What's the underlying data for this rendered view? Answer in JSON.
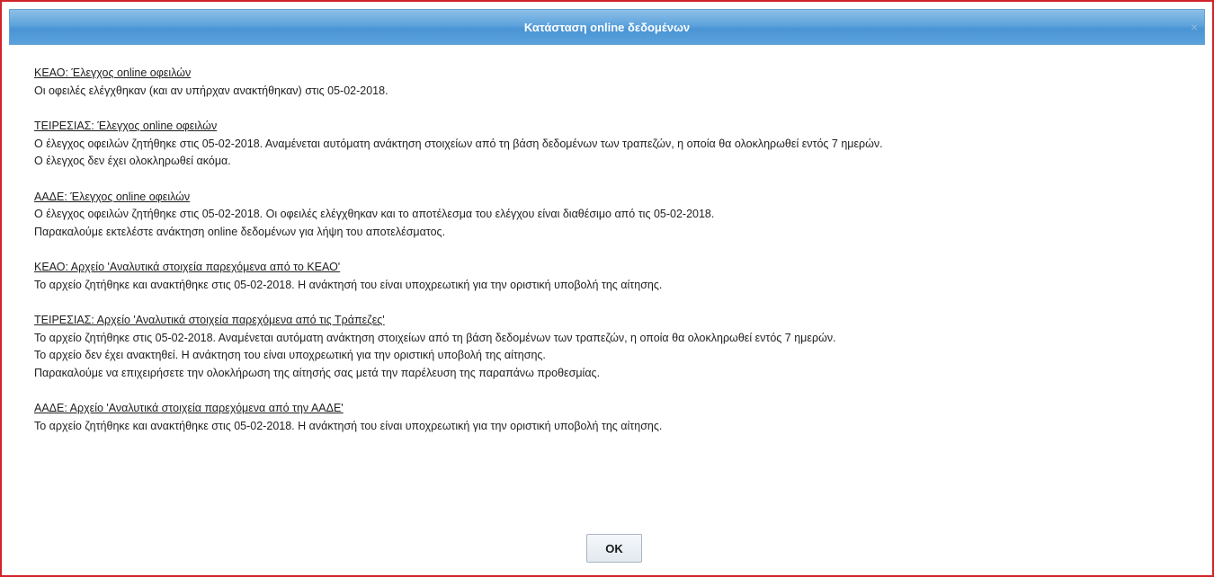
{
  "dialog": {
    "title": "Κατάσταση online δεδομένων",
    "close_icon": "×",
    "ok_label": "OK"
  },
  "sections": [
    {
      "title": "ΚΕΑΟ: Έλεγχος online οφειλών",
      "lines": [
        "Οι οφειλές ελέγχθηκαν (και αν υπήρχαν ανακτήθηκαν) στις 05-02-2018."
      ]
    },
    {
      "title": "ΤΕΙΡΕΣΙΑΣ: Έλεγχος online οφειλών",
      "lines": [
        "Ο έλεγχος οφειλών ζητήθηκε στις 05-02-2018. Αναμένεται αυτόματη ανάκτηση στοιχείων από τη βάση δεδομένων των τραπεζών, η οποία θα ολοκληρωθεί εντός 7 ημερών.",
        "Ο έλεγχος δεν έχει ολοκληρωθεί ακόμα."
      ]
    },
    {
      "title": "ΑΑΔΕ: Έλεγχος online οφειλών",
      "lines": [
        "Ο έλεγχος οφειλών ζητήθηκε στις 05-02-2018. Οι οφειλές ελέγχθηκαν και το αποτέλεσμα του ελέγχου είναι διαθέσιμο από τις 05-02-2018.",
        "Παρακαλούμε εκτελέστε ανάκτηση online δεδομένων για λήψη του αποτελέσματος."
      ]
    },
    {
      "title": "ΚΕΑΟ: Αρχείο 'Αναλυτικά στοιχεία παρεχόμενα από το ΚΕΑΟ'",
      "lines": [
        "Το αρχείο ζητήθηκε και ανακτήθηκε στις 05-02-2018. Η ανάκτησή του είναι υποχρεωτική για την οριστική υποβολή της αίτησης."
      ]
    },
    {
      "title": "ΤΕΙΡΕΣΙΑΣ: Αρχείο 'Αναλυτικά στοιχεία παρεχόμενα από τις Τράπεζες'",
      "lines": [
        "Το αρχείο ζητήθηκε στις 05-02-2018. Αναμένεται αυτόματη ανάκτηση στοιχείων από τη βάση δεδομένων των τραπεζών, η οποία θα ολοκληρωθεί εντός 7 ημερών.",
        "Το αρχείο δεν έχει ανακτηθεί. Η ανάκτηση του είναι υποχρεωτική για την οριστική υποβολή της αίτησης.",
        "Παρακαλούμε να επιχειρήσετε την ολοκλήρωση της αίτησής σας μετά την παρέλευση της παραπάνω προθεσμίας."
      ]
    },
    {
      "title": "ΑΑΔΕ: Αρχείο 'Αναλυτικά στοιχεία παρεχόμενα από την ΑΑΔΕ'",
      "lines": [
        "Το αρχείο ζητήθηκε και ανακτήθηκε στις 05-02-2018. Η ανάκτησή του είναι υποχρεωτική για την οριστική υποβολή της αίτησης."
      ]
    }
  ]
}
